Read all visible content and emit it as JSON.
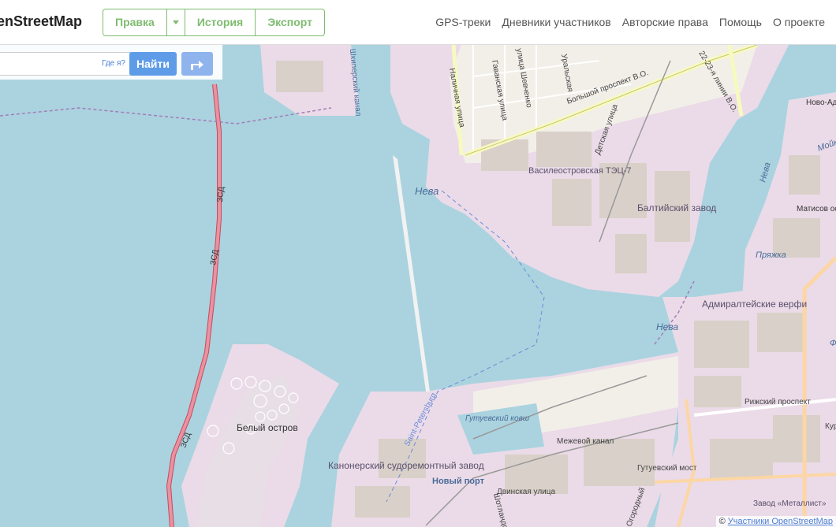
{
  "header": {
    "brand": "enStreetMap",
    "edit_label": "Правка",
    "history_label": "История",
    "export_label": "Экспорт",
    "nav": [
      "GPS-треки",
      "Дневники участников",
      "Авторские права",
      "Помощь",
      "О проекте"
    ]
  },
  "search": {
    "whereami": "Где я?",
    "go_label": "Найти"
  },
  "attribution": {
    "prefix": "©",
    "link": "Участники OpenStreetMap"
  },
  "map_labels": {
    "neva1": "Нева",
    "neva2": "Нева",
    "neva3": "Нева",
    "vasil_tec": "Василеостровская ТЭЦ-7",
    "baltic": "Балтийский завод",
    "admiralty": "Адмиралтейские верфи",
    "bely": "Белый остров",
    "kanoner": "Канонерский судоремонтный завод",
    "gutuevsky_kovsh": "Гутуевский ковш",
    "mezhevoy": "Межевой канал",
    "novy_port": "Новый порт",
    "dvinskaya": "Двинская улица",
    "gutuevsky_most": "Гутуевский мост",
    "rizhsky": "Рижский проспект",
    "zavod_metallist": "Завод «Металлист»",
    "pryazhka": "Пряжка",
    "matisov": "Матисов остров",
    "novo_adm": "Ново-Адм",
    "zsd1": "ЗСД",
    "zsd2": "ЗСД",
    "zsd3": "ЗСД",
    "bolshoy": "Большой проспект В.О.",
    "lines_22": "22-23-я линии В.О.",
    "detskaya": "Детская улица",
    "nalichnaya": "Наличная улица",
    "gavanskaya": "Гаванская улица",
    "shevchenko": "улица Шевченко",
    "shkipersky": "Шкиперский канал",
    "spb_channel": "Saint-Petersburg",
    "shotlandskaya": "Шотландская",
    "moika": "Мойка",
    "fontanka": "Ф",
    "kurs": "Кур",
    "uglovaya": "Огородный",
    "tatskaya": "Уральская"
  },
  "colors": {
    "water": "#aad3df",
    "industrial": "#ebdbe8",
    "building": "#d9d0c9",
    "motorway": "#e892a2",
    "accent": "#7ebc6f",
    "button": "#5e9ce8"
  }
}
